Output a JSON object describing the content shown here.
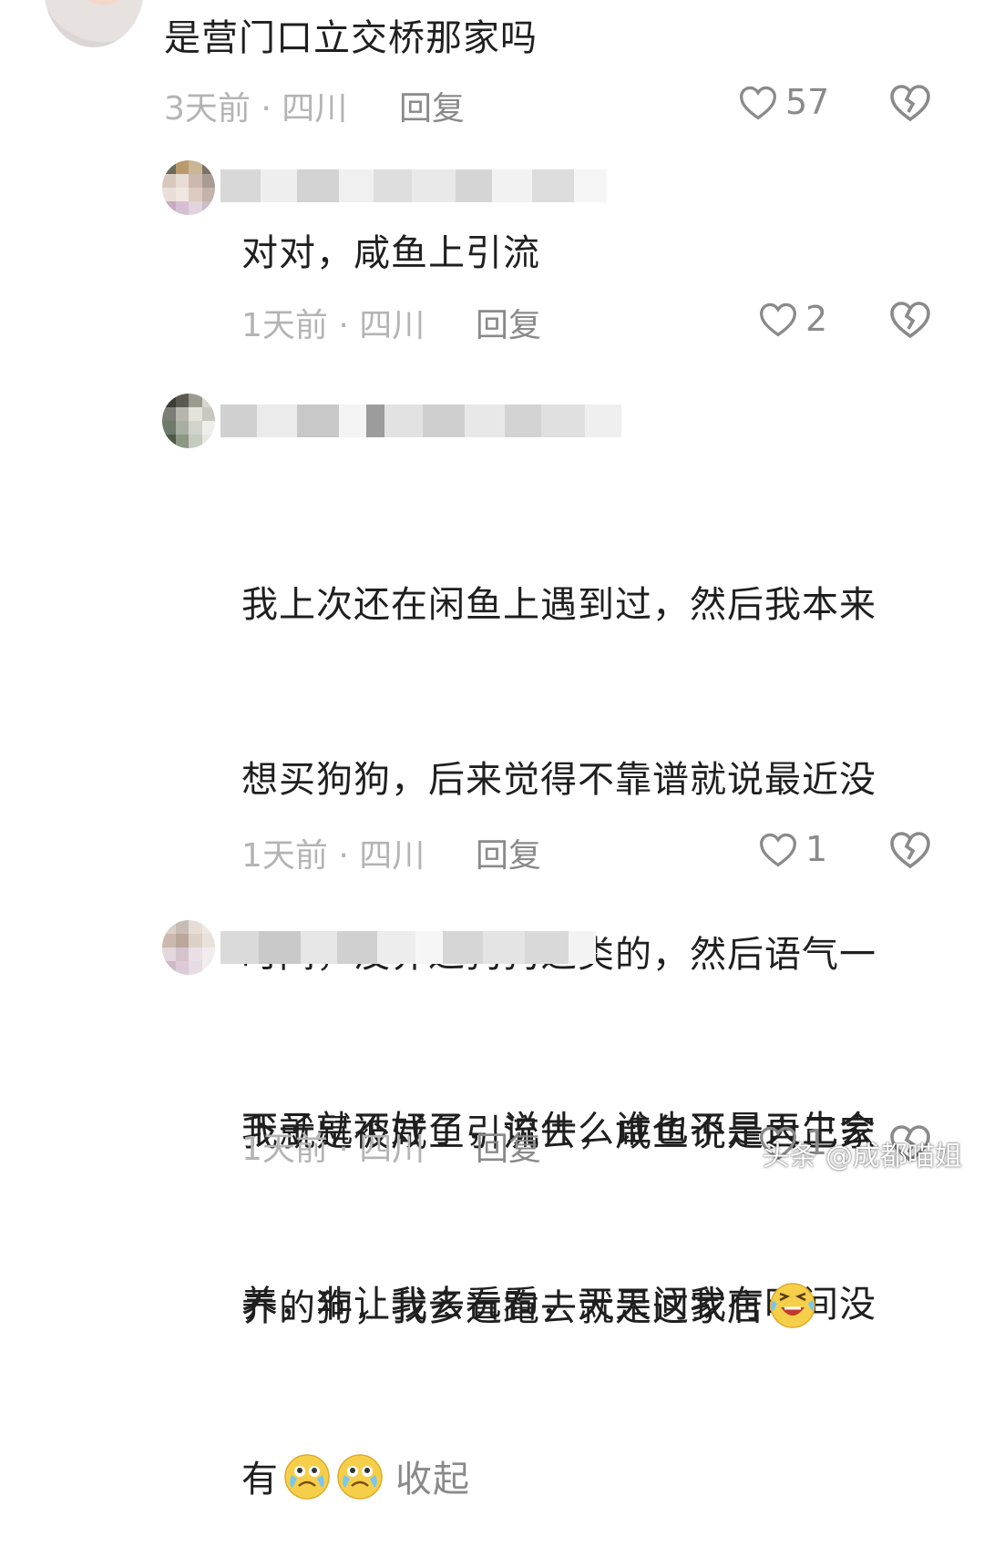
{
  "comments": [
    {
      "text": "是营门口立交桥那家吗",
      "time": "3天前",
      "region": "四川",
      "reply_label": "回复",
      "likes": "57"
    },
    {
      "text": "对对，咸鱼上引流",
      "time": "1天前",
      "region": "四川",
      "reply_label": "回复",
      "likes": "2"
    },
    {
      "lines": [
        "我上次还在闲鱼上遇到过，然后我本来",
        "想买狗狗，后来觉得不靠谱就说最近没",
        "时间，没养过狗狗之类的，然后语气一",
        "下子就不好了，说什么谁也不是天生会",
        "养，非让我去看看，天天问我有时间没",
        "有"
      ],
      "collapse_label": "收起",
      "time": "1天前",
      "region": "四川",
      "reply_label": "回复",
      "likes": "1"
    },
    {
      "lines": [
        "我就是被咸鱼引流去，咸鱼说是自己家",
        "养的狗，我多远跑去就是这家店"
      ],
      "time": "1天前",
      "region": "四川",
      "reply_label": "回复",
      "likes": "1"
    }
  ],
  "separator": "·",
  "watermark": "头条 @成都喵姐",
  "icons": [
    "heart-outline-icon",
    "broken-heart-icon",
    "crying-face-emoji",
    "laughing-crying-emoji"
  ],
  "colors": {
    "text": "#1f1f1f",
    "meta": "#b4b4b4",
    "action": "#8a8a8a"
  }
}
